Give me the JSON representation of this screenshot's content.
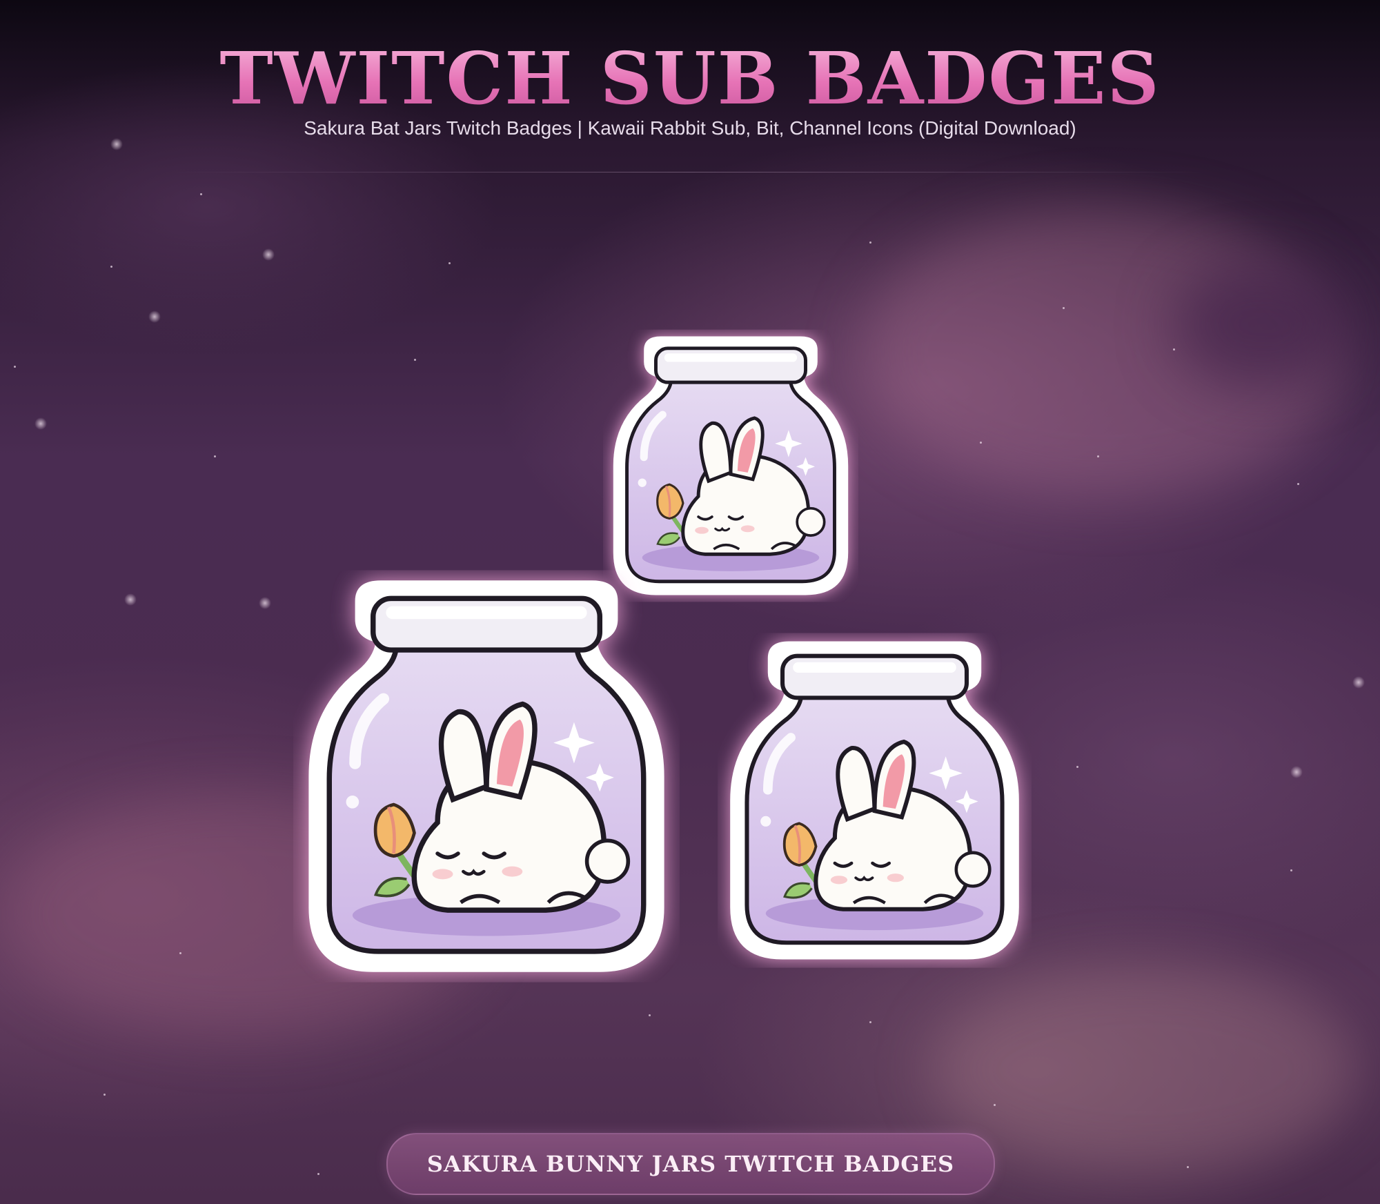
{
  "header": {
    "title": "TWITCH SUB BADGES",
    "subtitle": "Sakura Bat Jars Twitch Badges | Kawaii Rabbit Sub, Bit, Channel Icons (Digital Download)"
  },
  "badges": [
    {
      "name": "bunny-jar-small",
      "icon": "sleeping-bunny-jar"
    },
    {
      "name": "bunny-jar-large",
      "icon": "sleeping-bunny-jar"
    },
    {
      "name": "bunny-jar-medium",
      "icon": "sleeping-bunny-jar"
    }
  ],
  "footer": {
    "label": "SAKURA BUNNY JARS TWITCH BADGES"
  },
  "colors": {
    "title_pink": "#e673b6",
    "jar_purple": "#d9c6ec",
    "jar_floor": "#bba0da",
    "outline_glow": "#f2a6d8",
    "pill_bg": "#8c5582"
  }
}
